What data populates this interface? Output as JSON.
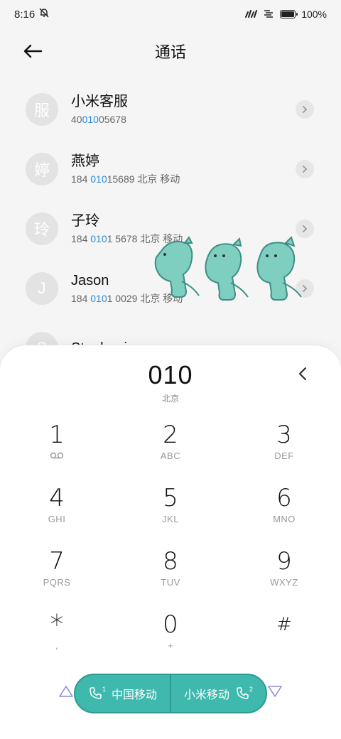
{
  "status_bar": {
    "time": "8:16",
    "battery": "100%"
  },
  "header": {
    "title": "通话"
  },
  "contacts": [
    {
      "avatar": "服",
      "name": "小米客服",
      "num_pre": "40",
      "num_hl": "010",
      "num_post": "05678",
      "location": ""
    },
    {
      "avatar": "婷",
      "name": "燕婷",
      "num_pre": "184 ",
      "num_hl": "010",
      "num_post": "15689",
      "location": "北京 移动"
    },
    {
      "avatar": "玲",
      "name": "子玲",
      "num_pre": "184 ",
      "num_hl": "010",
      "num_post": "1 5678",
      "location": "北京 移动"
    },
    {
      "avatar": "J",
      "name": "Jason",
      "num_pre": "184 ",
      "num_hl": "010",
      "num_post": "1 0029",
      "location": "北京 移动"
    },
    {
      "avatar": "S",
      "name": "Stephanie",
      "num_pre": "",
      "num_hl": "",
      "num_post": "",
      "location": ""
    }
  ],
  "dialpad": {
    "number": "010",
    "location": "北京",
    "keys": [
      {
        "digit": "1",
        "letters": ""
      },
      {
        "digit": "2",
        "letters": "ABC"
      },
      {
        "digit": "3",
        "letters": "DEF"
      },
      {
        "digit": "4",
        "letters": "GHI"
      },
      {
        "digit": "5",
        "letters": "JKL"
      },
      {
        "digit": "6",
        "letters": "MNO"
      },
      {
        "digit": "7",
        "letters": "PQRS"
      },
      {
        "digit": "8",
        "letters": "TUV"
      },
      {
        "digit": "9",
        "letters": "WXYZ"
      },
      {
        "digit": "*",
        "letters": ","
      },
      {
        "digit": "0",
        "letters": "+"
      },
      {
        "digit": "#",
        "letters": ""
      }
    ],
    "sim1": {
      "label": "中国移动",
      "slot": "1"
    },
    "sim2": {
      "label": "小米移动",
      "slot": "2"
    }
  },
  "colors": {
    "accent": "#3fb9ae",
    "highlight": "#2a8bd6",
    "triangle": "#8f8ad9"
  }
}
